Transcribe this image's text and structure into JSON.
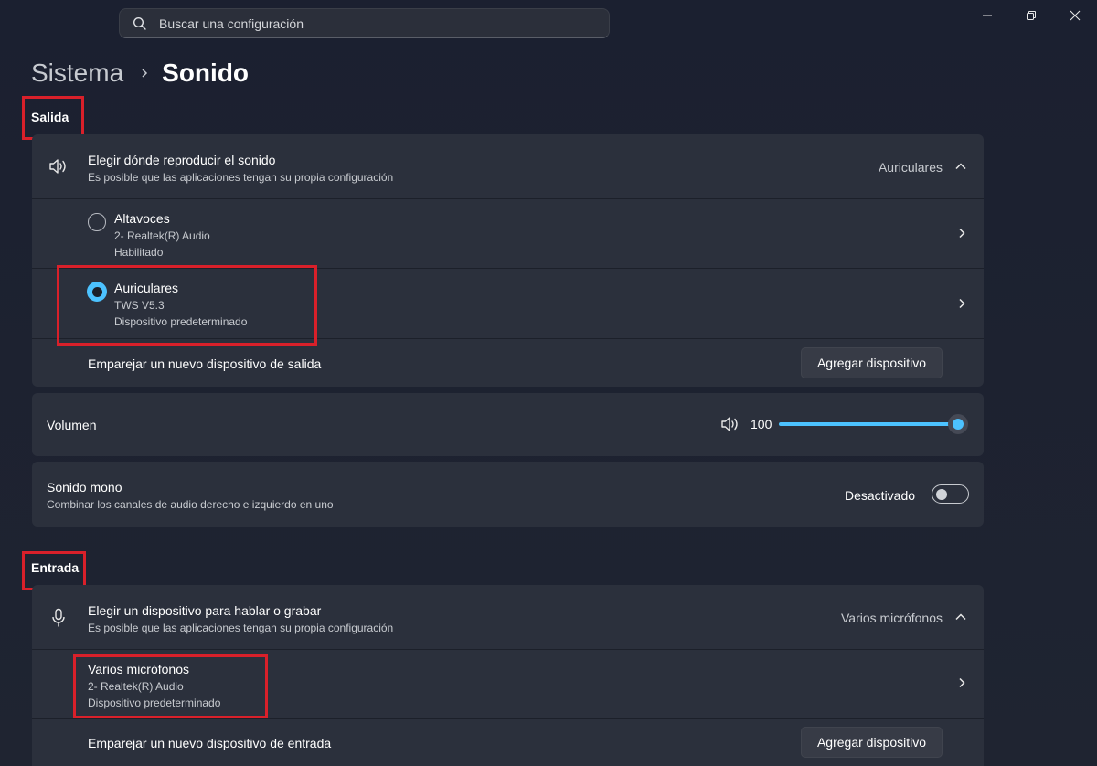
{
  "search": {
    "placeholder": "Buscar una configuración"
  },
  "breadcrumb": {
    "parent": "Sistema",
    "current": "Sonido"
  },
  "output": {
    "section_label": "Salida",
    "chooser": {
      "title": "Elegir dónde reproducir el sonido",
      "subtitle": "Es posible que las aplicaciones tengan su propia configuración",
      "selected": "Auriculares"
    },
    "devices": [
      {
        "name": "Altavoces",
        "detail": "2- Realtek(R) Audio",
        "status": "Habilitado",
        "selected": false
      },
      {
        "name": "Auriculares",
        "detail": "TWS V5.3",
        "status": "Dispositivo predeterminado",
        "selected": true
      }
    ],
    "pair": {
      "label": "Emparejar un nuevo dispositivo de salida",
      "button": "Agregar dispositivo"
    },
    "volume": {
      "label": "Volumen",
      "value": "100",
      "level": 1.0
    },
    "mono": {
      "title": "Sonido mono",
      "subtitle": "Combinar los canales de audio derecho e izquierdo en uno",
      "state": "Desactivado"
    }
  },
  "input": {
    "section_label": "Entrada",
    "chooser": {
      "title": "Elegir un dispositivo para hablar o grabar",
      "subtitle": "Es posible que las aplicaciones tengan su propia configuración",
      "selected": "Varios micrófonos"
    },
    "devices": [
      {
        "name": "Varios micrófonos",
        "detail": "2- Realtek(R) Audio",
        "status": "Dispositivo predeterminado"
      }
    ],
    "pair": {
      "label": "Emparejar un nuevo dispositivo de entrada",
      "button": "Agregar dispositivo"
    }
  },
  "colors": {
    "accent": "#4cc2ff",
    "highlight": "#d9202a",
    "card": "#2b303c"
  }
}
